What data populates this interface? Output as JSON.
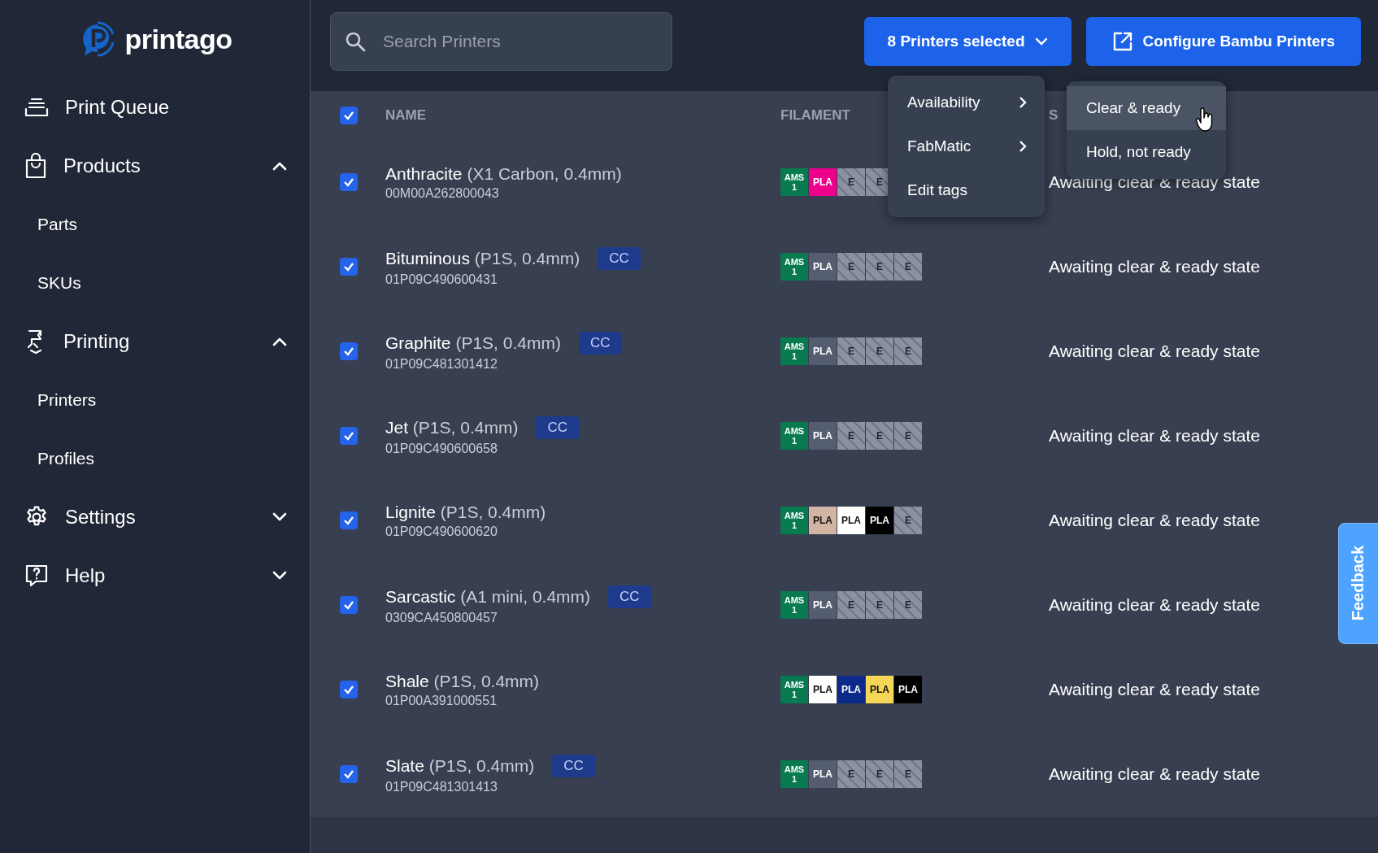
{
  "logo": {
    "text": "printago"
  },
  "sidebar": {
    "items": [
      {
        "label": "Print Queue"
      },
      {
        "label": "Products",
        "expanded": true,
        "children": [
          {
            "label": "Parts"
          },
          {
            "label": "SKUs"
          }
        ]
      },
      {
        "label": "Printing",
        "expanded": true,
        "children": [
          {
            "label": "Printers"
          },
          {
            "label": "Profiles"
          }
        ]
      },
      {
        "label": "Settings",
        "expanded": false
      },
      {
        "label": "Help",
        "expanded": false
      }
    ]
  },
  "search": {
    "placeholder": "Search Printers"
  },
  "selection_button": {
    "label": "8 Printers selected"
  },
  "configure_button": {
    "label": "Configure Bambu Printers"
  },
  "menu": {
    "items": [
      {
        "label": "Availability",
        "submenu": true
      },
      {
        "label": "FabMatic",
        "submenu": true
      },
      {
        "label": "Edit tags",
        "submenu": false
      }
    ]
  },
  "submenu": {
    "items": [
      {
        "label": "Clear & ready",
        "selected": true
      },
      {
        "label": "Hold, not ready",
        "selected": false
      }
    ]
  },
  "table": {
    "all_checked": true,
    "columns": [
      "NAME",
      "FILAMENT",
      "S"
    ],
    "rows": [
      {
        "checked": true,
        "name": "Anthracite",
        "model": "(X1 Carbon, 0.4mm)",
        "serial": "00M00A262800043",
        "tags": [],
        "slots": [
          {
            "kind": "ams",
            "label": "AMS 1"
          },
          {
            "kind": "filament",
            "label": "PLA",
            "color": "#ec008c"
          },
          {
            "kind": "empty",
            "label": "E"
          },
          {
            "kind": "empty",
            "label": "E"
          }
        ],
        "status": "Awaiting clear & ready state"
      },
      {
        "checked": true,
        "name": "Bituminous",
        "model": "(P1S, 0.4mm)",
        "serial": "01P09C490600431",
        "tags": [
          "CC"
        ],
        "slots": [
          {
            "kind": "ams",
            "label": "AMS 1"
          },
          {
            "kind": "filament",
            "label": "PLA",
            "color": "#555e70"
          },
          {
            "kind": "empty",
            "label": "E"
          },
          {
            "kind": "empty",
            "label": "E"
          },
          {
            "kind": "empty",
            "label": "E"
          }
        ],
        "status": "Awaiting clear & ready state"
      },
      {
        "checked": true,
        "name": "Graphite",
        "model": "(P1S, 0.4mm)",
        "serial": "01P09C481301412",
        "tags": [
          "CC"
        ],
        "slots": [
          {
            "kind": "ams",
            "label": "AMS 1"
          },
          {
            "kind": "filament",
            "label": "PLA",
            "color": "#555e70"
          },
          {
            "kind": "empty",
            "label": "E"
          },
          {
            "kind": "empty",
            "label": "E"
          },
          {
            "kind": "empty",
            "label": "E"
          }
        ],
        "status": "Awaiting clear & ready state"
      },
      {
        "checked": true,
        "name": "Jet",
        "model": "(P1S, 0.4mm)",
        "serial": "01P09C490600658",
        "tags": [
          "CC"
        ],
        "slots": [
          {
            "kind": "ams",
            "label": "AMS 1"
          },
          {
            "kind": "filament",
            "label": "PLA",
            "color": "#555e70"
          },
          {
            "kind": "empty",
            "label": "E"
          },
          {
            "kind": "empty",
            "label": "E"
          },
          {
            "kind": "empty",
            "label": "E"
          }
        ],
        "status": "Awaiting clear & ready state"
      },
      {
        "checked": true,
        "name": "Lignite",
        "model": "(P1S, 0.4mm)",
        "serial": "01P09C490600620",
        "tags": [],
        "slots": [
          {
            "kind": "ams",
            "label": "AMS 1"
          },
          {
            "kind": "filament",
            "label": "PLA",
            "color": "#d2b4a4"
          },
          {
            "kind": "filament",
            "label": "PLA",
            "color": "#ffffff"
          },
          {
            "kind": "filament",
            "label": "PLA",
            "color": "#000000"
          },
          {
            "kind": "empty",
            "label": "E"
          }
        ],
        "status": "Awaiting clear & ready state"
      },
      {
        "checked": true,
        "name": "Sarcastic",
        "model": "(A1 mini, 0.4mm)",
        "serial": "0309CA450800457",
        "tags": [
          "CC"
        ],
        "slots": [
          {
            "kind": "ams",
            "label": "AMS 1"
          },
          {
            "kind": "filament",
            "label": "PLA",
            "color": "#555e70"
          },
          {
            "kind": "empty",
            "label": "E"
          },
          {
            "kind": "empty",
            "label": "E"
          },
          {
            "kind": "empty",
            "label": "E"
          }
        ],
        "status": "Awaiting clear & ready state"
      },
      {
        "checked": true,
        "name": "Shale",
        "model": "(P1S, 0.4mm)",
        "serial": "01P00A391000551",
        "tags": [],
        "slots": [
          {
            "kind": "ams",
            "label": "AMS 1"
          },
          {
            "kind": "filament",
            "label": "PLA",
            "color": "#ffffff"
          },
          {
            "kind": "filament",
            "label": "PLA",
            "color": "#0c2a8a"
          },
          {
            "kind": "filament",
            "label": "PLA",
            "color": "#f5d657"
          },
          {
            "kind": "filament",
            "label": "PLA",
            "color": "#000000"
          }
        ],
        "status": "Awaiting clear & ready state"
      },
      {
        "checked": true,
        "name": "Slate",
        "model": "(P1S, 0.4mm)",
        "serial": "01P09C481301413",
        "tags": [
          "CC"
        ],
        "slots": [
          {
            "kind": "ams",
            "label": "AMS 1"
          },
          {
            "kind": "filament",
            "label": "PLA",
            "color": "#555e70"
          },
          {
            "kind": "empty",
            "label": "E"
          },
          {
            "kind": "empty",
            "label": "E"
          },
          {
            "kind": "empty",
            "label": "E"
          }
        ],
        "status": "Awaiting clear & ready state"
      }
    ]
  },
  "feedback": {
    "label": "Feedback"
  }
}
